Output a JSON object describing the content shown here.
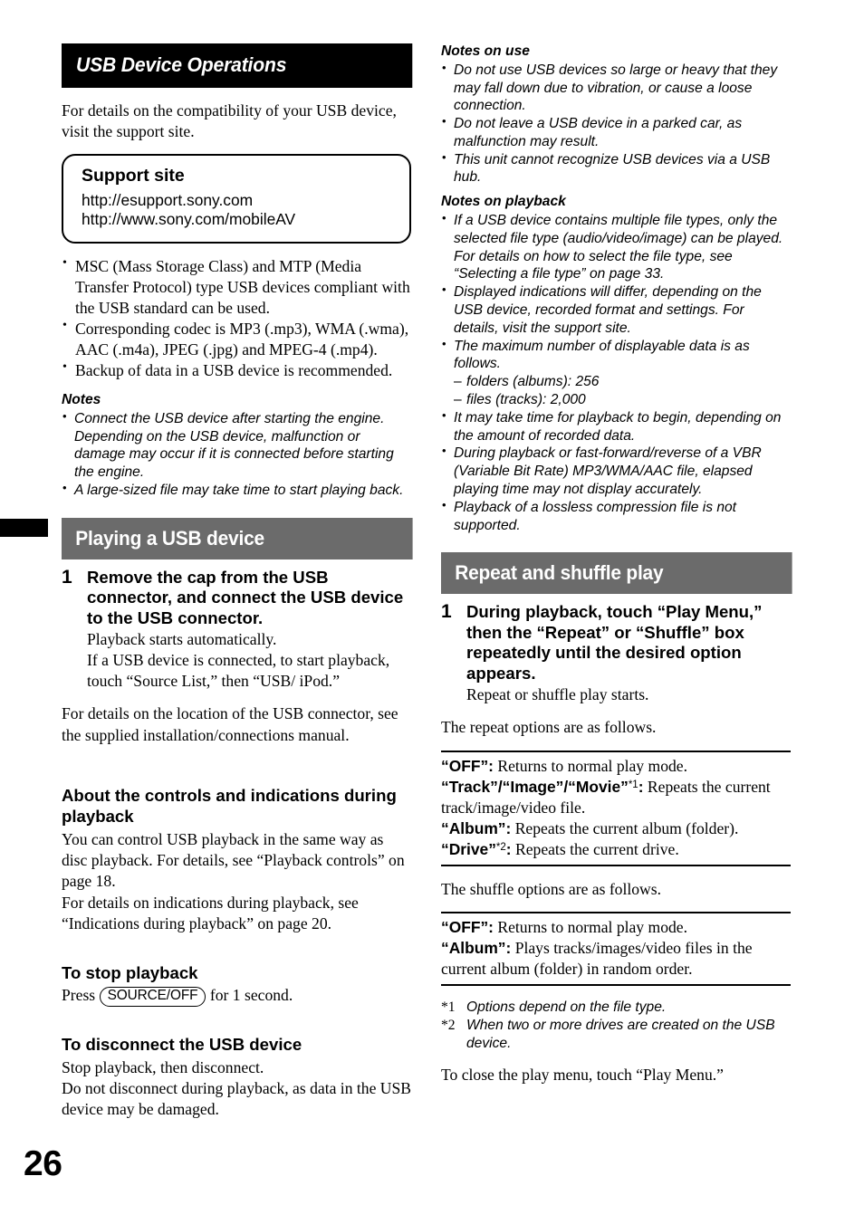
{
  "page": {
    "number": "26",
    "thumb_tab": true,
    "bar_color_chapter": "#000000",
    "bar_color_section": "#6b6b6b"
  },
  "left_column": {
    "chapter_title": "USB Device Operations",
    "intro": "For details on the compatibility of your USB device, visit the support site.",
    "support_box": {
      "title": "Support site",
      "url1": "http://esupport.sony.com",
      "url2": "http://www.sony.com/mobileAV"
    },
    "feature_bullets": [
      "MSC (Mass Storage Class) and MTP (Media Transfer Protocol) type USB devices compliant with the USB standard can be used.",
      "Corresponding codec is MP3 (.mp3), WMA (.wma), AAC (.m4a), JPEG (.jpg) and MPEG-4 (.mp4).",
      "Backup of data in a USB device is recommended."
    ],
    "notes_heading": "Notes",
    "notes": [
      "Connect the USB device after starting the engine. Depending on the USB device, malfunction or damage may occur if it is connected before starting the engine.",
      "A large-sized file may take time to start playing back."
    ],
    "section_title": "Playing a USB device",
    "step1": {
      "number": "1",
      "title": "Remove the cap from the USB connector, and connect the USB device to the USB connector.",
      "desc_line1": "Playback starts automatically.",
      "desc_line2": "If a USB device is connected, to start playback, touch “Source List,” then “USB/ iPod.”"
    },
    "after_step_note": "For details on the location of the USB connector, see the supplied installation/connections manual.",
    "controls_heading": "About the controls and indications during playback",
    "controls_body_1": "You can control USB playback in the same way as disc playback. For details, see “Playback controls” on page 18.",
    "controls_body_2": "For details on indications during playback, see “Indications during playback” on page 20.",
    "stop_heading": "To stop playback",
    "stop_text_before": "Press",
    "stop_key": "SOURCE/OFF",
    "stop_text_after": "for 1 second.",
    "disconnect_heading": "To disconnect the USB device",
    "disconnect_line1": "Stop playback, then disconnect.",
    "disconnect_line2": "Do not disconnect during playback, as data in the USB device may be damaged."
  },
  "right_column": {
    "notes_on_use_heading": "Notes on use",
    "notes_on_use": [
      "Do not use USB devices so large or heavy that they may fall down due to vibration, or cause a loose connection.",
      "Do not leave a USB device in a parked car, as malfunction may result.",
      "This unit cannot recognize USB devices via a USB hub."
    ],
    "notes_on_playback_heading": "Notes on playback",
    "notes_on_playback": [
      "If a USB device contains multiple file types, only the selected file type (audio/video/image) can be played. For details on how to select the file type, see “Selecting a file type” on page 33.",
      "Displayed indications will differ, depending on the USB device, recorded format and settings. For details, visit the support site.",
      "The maximum number of displayable data is as follows.",
      "It may take time for playback to begin, depending on the amount of recorded data.",
      "During playback or fast-forward/reverse of a VBR (Variable Bit Rate) MP3/WMA/AAC file, elapsed playing time may not display accurately.",
      "Playback of a lossless compression file is not supported."
    ],
    "max_data_sub": [
      "folders (albums): 256",
      "files (tracks): 2,000"
    ],
    "section_title": "Repeat and shuffle play",
    "step1": {
      "number": "1",
      "title": "During playback, touch “Play Menu,” then the “Repeat” or “Shuffle” box repeatedly until the desired option appears.",
      "desc": "Repeat or shuffle play starts."
    },
    "repeat_intro": "The repeat options are as follows.",
    "repeat_options": [
      {
        "key": "“OFF”:",
        "footnote": "",
        "desc": " Returns to normal play mode."
      },
      {
        "key": "“Track”/“Image”/“Movie”",
        "footnote": "*1",
        "desc": ": Repeats the current track/image/video file."
      },
      {
        "key": "“Album”:",
        "footnote": "",
        "desc": " Repeats the current album (folder)."
      },
      {
        "key": "“Drive”",
        "footnote": "*2",
        "desc": ": Repeats the current drive."
      }
    ],
    "shuffle_intro": "The shuffle options are as follows.",
    "shuffle_options": [
      {
        "key": "“OFF”:",
        "footnote": "",
        "desc": " Returns to normal play mode."
      },
      {
        "key": "“Album”:",
        "footnote": "",
        "desc": " Plays tracks/images/video files in the current album (folder) in random order."
      }
    ],
    "footnotes": [
      {
        "mark": "*1",
        "text": "Options depend on the file type."
      },
      {
        "mark": "*2",
        "text": "When two or more drives are created on the USB device."
      }
    ],
    "closing": "To close the play menu, touch “Play Menu.”"
  }
}
